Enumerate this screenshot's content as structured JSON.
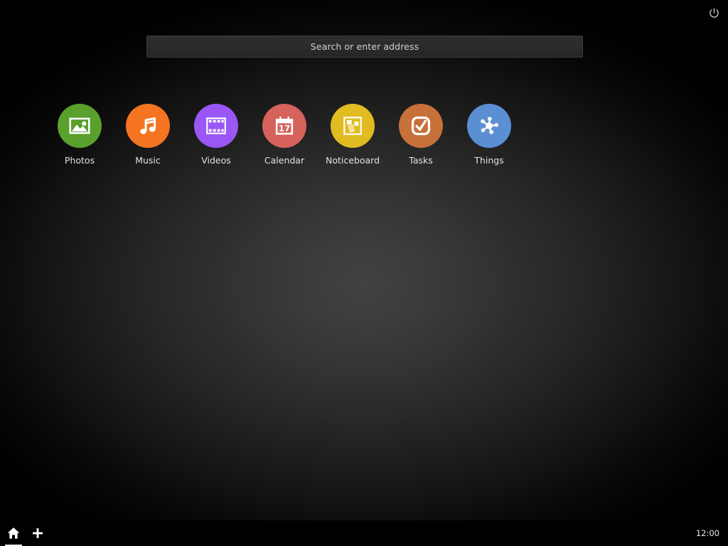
{
  "window": {
    "title": "Home Screen"
  },
  "colors": {
    "background_center": "#3b3b3b",
    "background_edge": "#000000",
    "search_bar_fill": "#2b2b2b",
    "search_bar_border": "#3a3a3a",
    "text": "#e2e2e2",
    "photos": "#5aa02c",
    "music": "#f47421",
    "videos": "#9a57f5",
    "calendar": "#d6625c",
    "noticeboard": "#e0bc22",
    "tasks": "#c8703a",
    "things": "#5b8fd4",
    "icon_glyph": "#ffffff"
  },
  "topbar": {
    "power_icon": "power-icon",
    "power_label": "Power"
  },
  "search": {
    "placeholder": "Search or enter address",
    "value": "",
    "icon": "address-bar"
  },
  "apps": [
    {
      "label": "Photos",
      "icon": "photos-icon",
      "color": "#5aa02c"
    },
    {
      "label": "Music",
      "icon": "music-note-icon",
      "color": "#f47421"
    },
    {
      "label": "Videos",
      "icon": "film-strip-icon",
      "color": "#9a57f5"
    },
    {
      "label": "Calendar",
      "icon": "calendar-icon",
      "color": "#d6625c",
      "day": "17"
    },
    {
      "label": "Noticeboard",
      "icon": "noticeboard-icon",
      "color": "#e0bc22"
    },
    {
      "label": "Tasks",
      "icon": "checkbox-icon",
      "color": "#c8703a"
    },
    {
      "label": "Things",
      "icon": "hub-nodes-icon",
      "color": "#5b8fd4"
    }
  ],
  "taskbar": {
    "home_icon": "home-icon",
    "home_label": "Home",
    "add_icon": "plus-icon",
    "add_label": "New tab",
    "clock": "12:00"
  }
}
